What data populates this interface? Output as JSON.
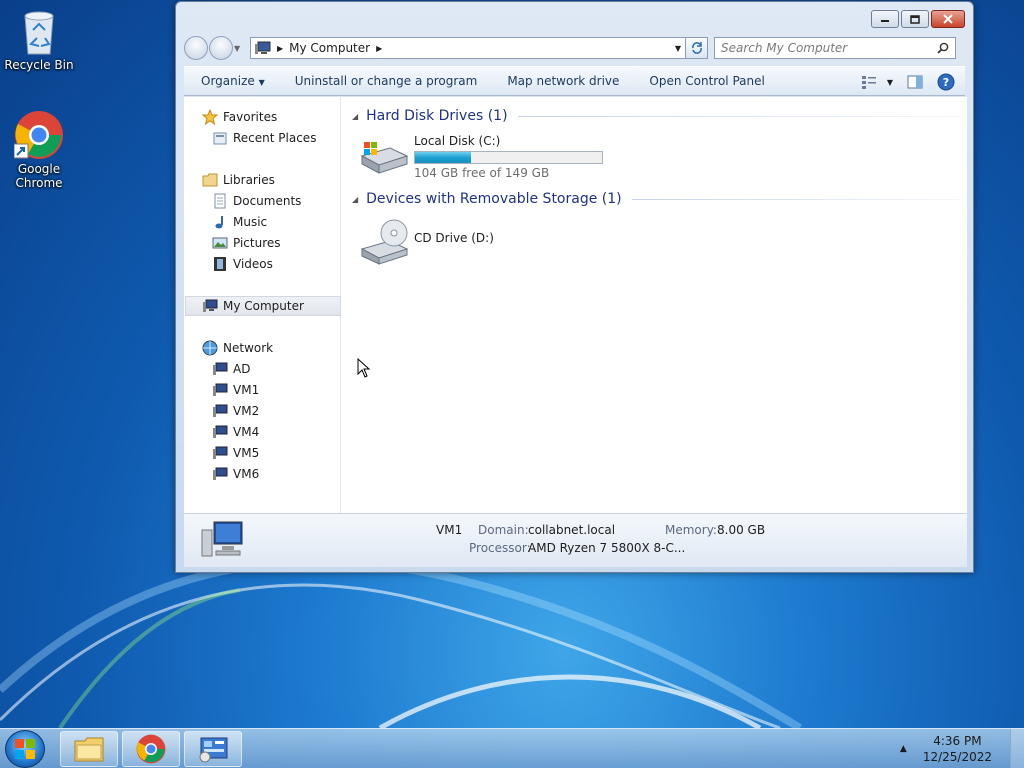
{
  "desktop": {
    "icons": [
      {
        "label": "Recycle Bin",
        "icon": "recycle-bin-icon"
      },
      {
        "label": "Google Chrome",
        "icon": "chrome-icon"
      }
    ]
  },
  "window": {
    "breadcrumb": "My Computer",
    "search_placeholder": "Search My Computer"
  },
  "toolbar": {
    "items": [
      "Organize",
      "Uninstall or change a program",
      "Map network drive",
      "Open Control Panel"
    ]
  },
  "nav": {
    "favorites": "Favorites",
    "recent_places": "Recent Places",
    "libraries": "Libraries",
    "documents": "Documents",
    "music": "Music",
    "pictures": "Pictures",
    "videos": "Videos",
    "my_computer": "My Computer",
    "network": "Network",
    "network_items": [
      "AD",
      "VM1",
      "VM2",
      "VM4",
      "VM5",
      "VM6"
    ]
  },
  "main": {
    "groups": [
      {
        "header": "Hard Disk Drives (1)",
        "drives": [
          {
            "name": "Local Disk (C:)",
            "free_text": "104 GB free of 149 GB",
            "used_fraction": 0.3
          }
        ]
      },
      {
        "header": "Devices with Removable Storage (1)",
        "drives": [
          {
            "name": "CD Drive (D:)"
          }
        ]
      }
    ]
  },
  "details": {
    "computer_name": "VM1",
    "domain_label": "Domain:",
    "domain_value": "collabnet.local",
    "memory_label": "Memory:",
    "memory_value": "8.00 GB",
    "processor_label": "Processor:",
    "processor_value": "AMD Ryzen 7 5800X 8-C..."
  },
  "taskbar": {
    "time": "4:36 PM",
    "date": "12/25/2022"
  },
  "colors": {
    "usage_fill": "#1ea0d2",
    "group_header": "#1e3287",
    "close_button": "#c9442b"
  }
}
